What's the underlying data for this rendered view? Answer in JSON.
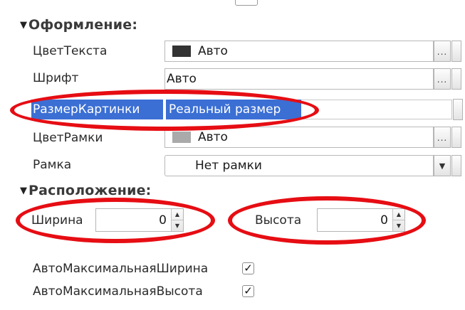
{
  "sections": {
    "appearance": "Оформление:",
    "placement": "Расположение:"
  },
  "properties": {
    "text_color": {
      "label": "ЦветТекста",
      "value": "Авто",
      "swatch_color": "#333333"
    },
    "font": {
      "label": "Шрифт",
      "value": "Авто"
    },
    "picture_size": {
      "label": "РазмерКартинки",
      "value": "Реальный размер"
    },
    "border_color": {
      "label": "ЦветРамки",
      "value": "Авто",
      "swatch_color": "#aaaaaa"
    },
    "border": {
      "label": "Рамка",
      "value": "Нет рамки"
    }
  },
  "buttons": {
    "select_label": "...",
    "dropdown_glyph": "▼"
  },
  "placement": {
    "width": {
      "label": "Ширина",
      "value": "0"
    },
    "height": {
      "label": "Высота",
      "value": "0"
    }
  },
  "checkboxes": {
    "auto_max_width": {
      "label": "АвтоМаксимальнаяШирина",
      "checked": true,
      "mark": "✓"
    },
    "auto_max_height": {
      "label": "АвтоМаксимальнаяВысота",
      "checked": true,
      "mark": "✓"
    }
  },
  "colors": {
    "selection": "#3b6fd4",
    "annotation": "#e60d13"
  }
}
